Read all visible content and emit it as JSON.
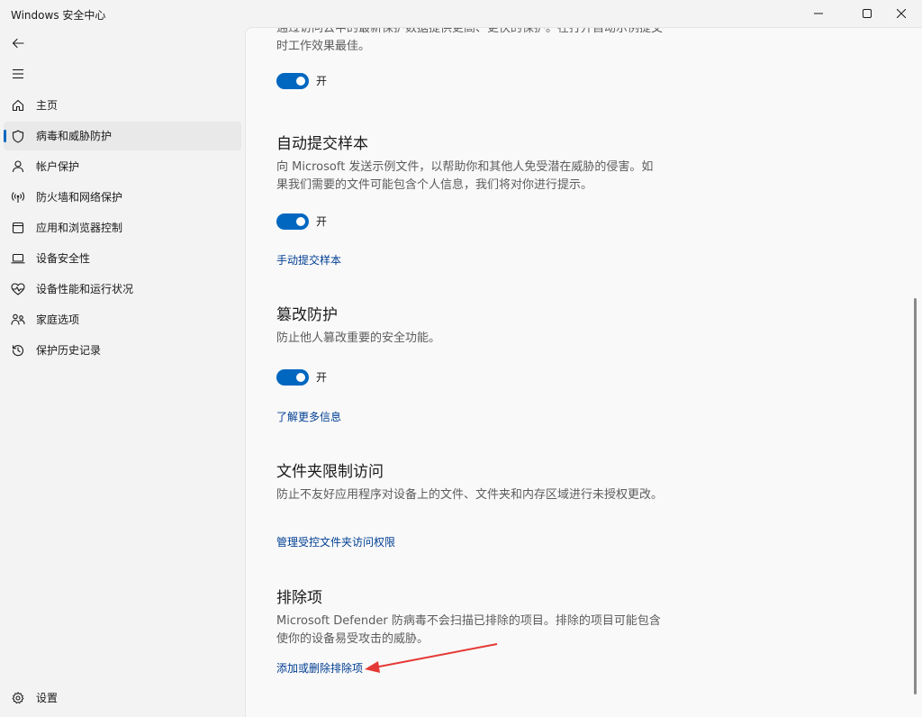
{
  "window": {
    "title": "Windows 安全中心"
  },
  "sidebar": {
    "items": [
      {
        "label": "主页",
        "icon": "home-icon"
      },
      {
        "label": "病毒和威胁防护",
        "icon": "shield-icon",
        "active": true
      },
      {
        "label": "帐户保护",
        "icon": "person-icon"
      },
      {
        "label": "防火墙和网络保护",
        "icon": "wifi-antenna-icon"
      },
      {
        "label": "应用和浏览器控制",
        "icon": "app-window-icon"
      },
      {
        "label": "设备安全性",
        "icon": "laptop-icon"
      },
      {
        "label": "设备性能和运行状况",
        "icon": "heart-pulse-icon"
      },
      {
        "label": "家庭选项",
        "icon": "family-icon"
      },
      {
        "label": "保护历史记录",
        "icon": "history-icon"
      }
    ],
    "settings_label": "设置"
  },
  "main": {
    "cloud_protection": {
      "desc_partial": "通过访问云中的最新保护数据提供更高、更快的保护。在打开自动示例提交时工作效果最佳。",
      "toggle_label": "开"
    },
    "auto_sample": {
      "heading": "自动提交样本",
      "desc": "向 Microsoft 发送示例文件，以帮助你和其他人免受潜在威胁的侵害。如果我们需要的文件可能包含个人信息，我们将对你进行提示。",
      "toggle_label": "开",
      "link": "手动提交样本"
    },
    "tamper": {
      "heading": "篡改防护",
      "desc": "防止他人篡改重要的安全功能。",
      "toggle_label": "开",
      "link": "了解更多信息"
    },
    "folder_access": {
      "heading": "文件夹限制访问",
      "desc": "防止不友好应用程序对设备上的文件、文件夹和内存区域进行未授权更改。",
      "link": "管理受控文件夹访问权限"
    },
    "exclusions": {
      "heading": "排除项",
      "desc": "Microsoft Defender 防病毒不会扫描已排除的项目。排除的项目可能包含使你的设备易受攻击的威胁。",
      "link": "添加或删除排除项"
    }
  },
  "colors": {
    "accent": "#0067c0",
    "link": "#003e92",
    "annotation_arrow": "#e53935"
  }
}
